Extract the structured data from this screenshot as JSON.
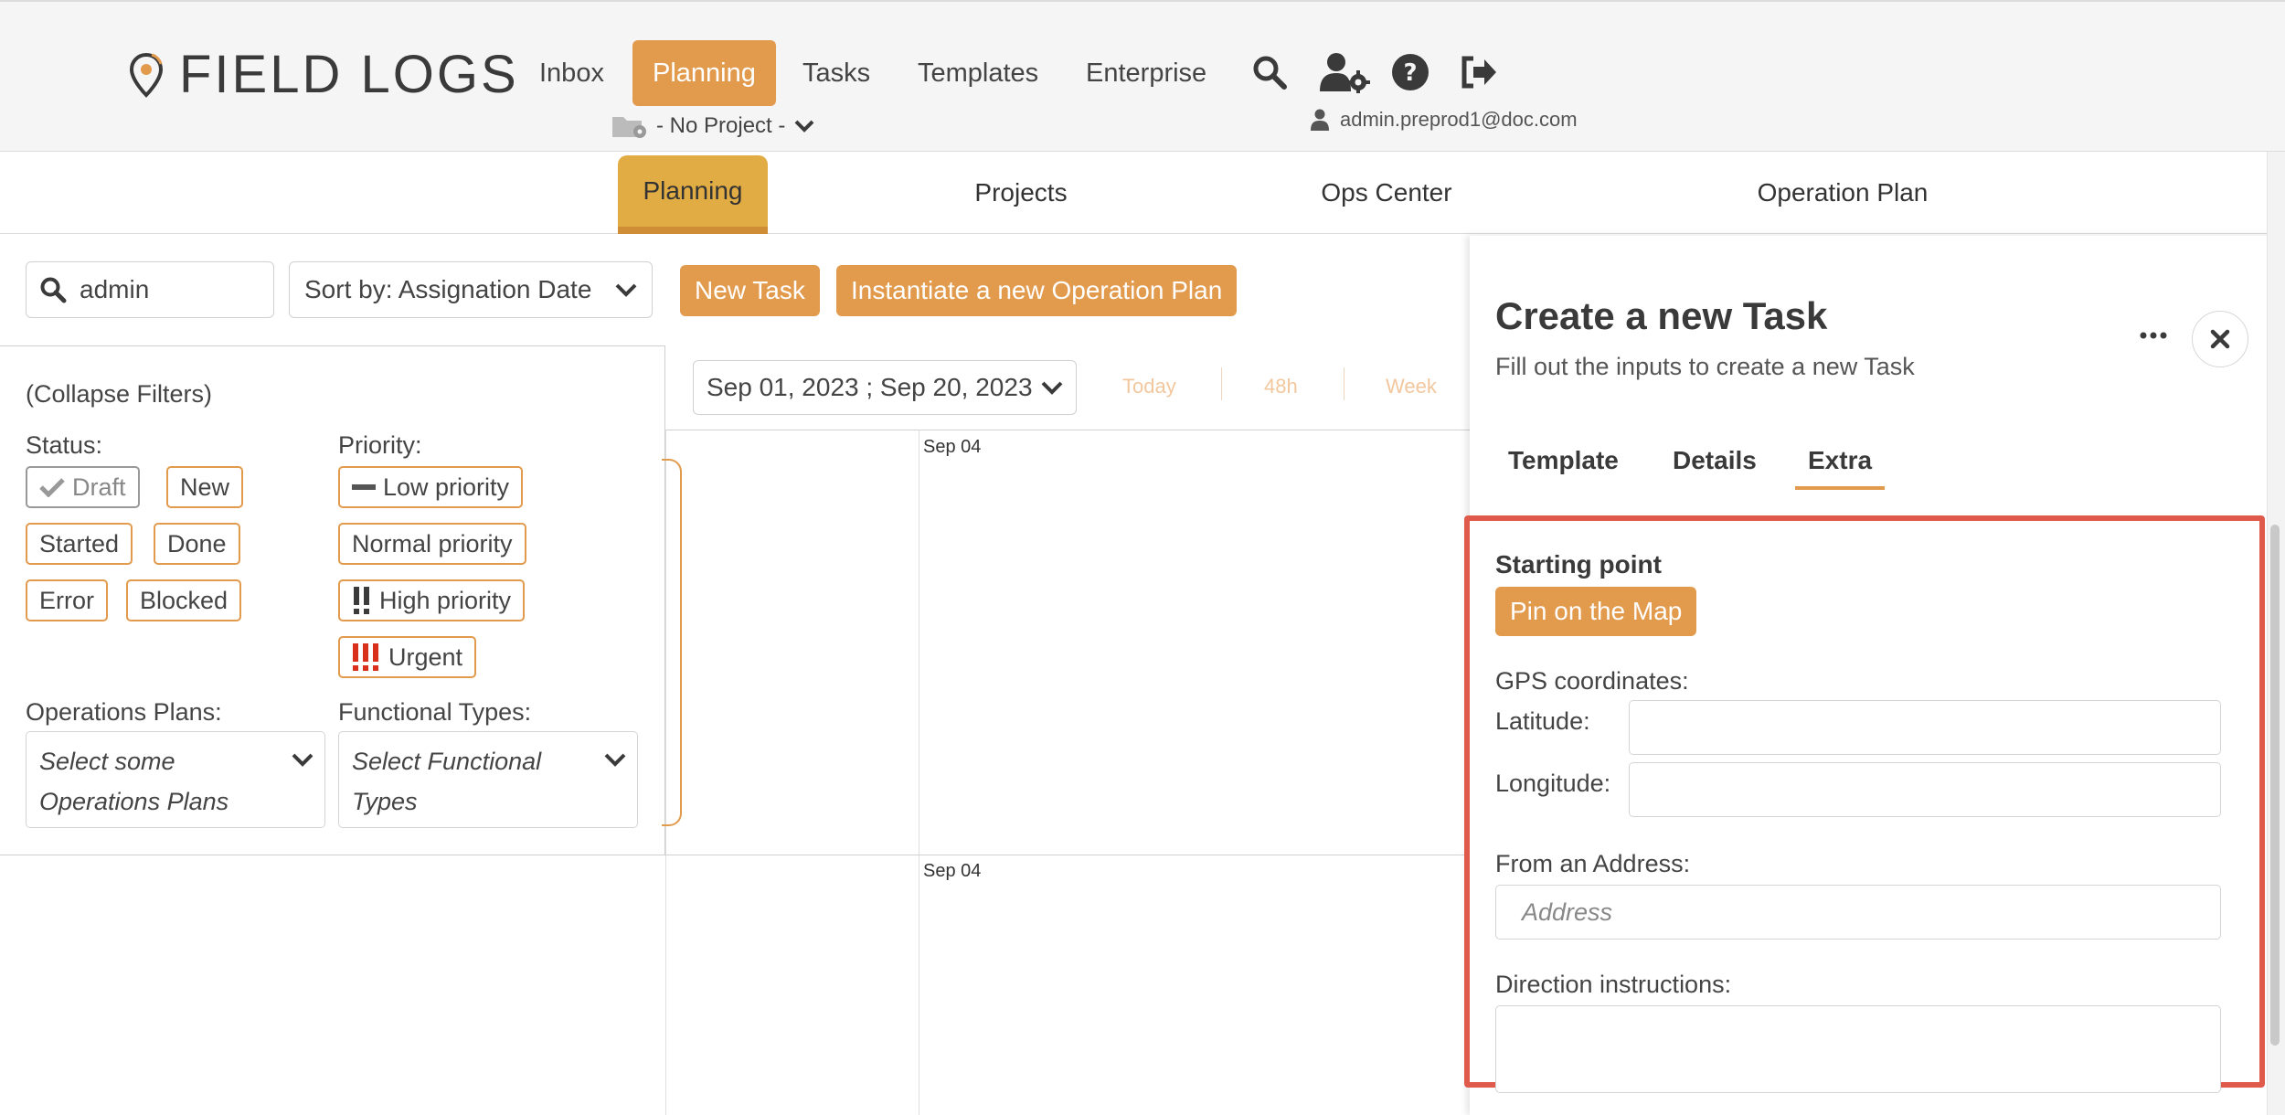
{
  "app": {
    "brand": "FIELD LOGS",
    "accent": "#e29a4d",
    "highlight": "#e05a4c"
  },
  "nav": {
    "items": [
      "Inbox",
      "Planning",
      "Tasks",
      "Templates",
      "Enterprise"
    ],
    "active": "Planning"
  },
  "header": {
    "icons": [
      "search-icon",
      "user-settings-icon",
      "help-icon",
      "logout-icon"
    ],
    "project": "- No Project -",
    "user": "admin.preprod1@doc.com"
  },
  "subtabs": {
    "items": [
      "Planning",
      "Projects",
      "Ops Center",
      "Operation Plan"
    ],
    "active": "Planning"
  },
  "toolbar": {
    "search_value": "admin",
    "sort_label": "Sort by: Assignation Date",
    "new_task": "New Task",
    "instantiate": "Instantiate a new Operation Plan"
  },
  "filters": {
    "collapse": "(Collapse Filters)",
    "status_label": "Status:",
    "status": [
      "Draft",
      "New",
      "Started",
      "Done",
      "Error",
      "Blocked"
    ],
    "priority_label": "Priority:",
    "priority": [
      "Low priority",
      "Normal priority",
      "High priority",
      "Urgent"
    ],
    "ops_label": "Operations Plans:",
    "ops_placeholder": "Select some Operations Plans",
    "func_label": "Functional Types:",
    "func_placeholder": "Select Functional Types"
  },
  "calendar": {
    "range": "Sep 01, 2023 ; Sep 20, 2023",
    "buttons": [
      "Today",
      "48h",
      "Week"
    ],
    "days": [
      "Sep 04",
      "Sep 04"
    ]
  },
  "panel": {
    "title": "Create a new Task",
    "subtitle": "Fill out the inputs to create a new Task",
    "tabs": [
      "Template",
      "Details",
      "Extra"
    ],
    "active_tab": "Extra",
    "starting_point": "Starting point",
    "pin_button": "Pin on the Map",
    "gps_label": "GPS coordinates:",
    "latitude_label": "Latitude:",
    "longitude_label": "Longitude:",
    "address_label": "From an Address:",
    "address_placeholder": "Address",
    "direction_label": "Direction instructions:"
  }
}
